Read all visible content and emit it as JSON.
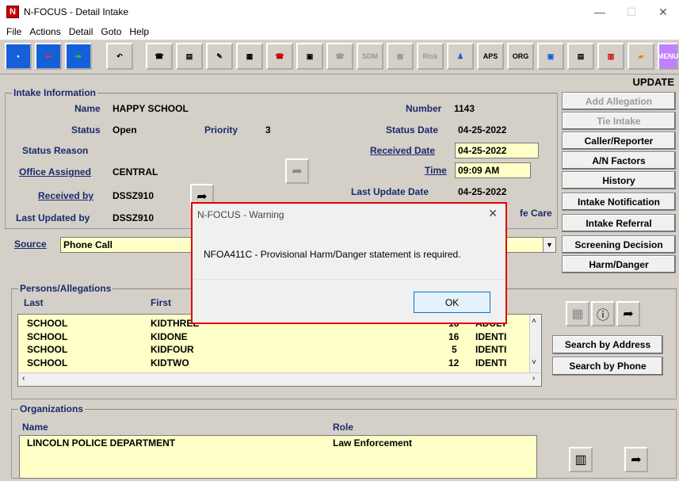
{
  "window": {
    "title": "N-FOCUS - Detail Intake",
    "app_icon_text": "N"
  },
  "menu": [
    "File",
    "Actions",
    "Detail",
    "Goto",
    "Help"
  ],
  "toolbar": {
    "sdm_label": "SDM",
    "risk_label": "Risk",
    "aps_label": "APS",
    "org_label": "ORG",
    "menu_label": "MENU"
  },
  "mode": "UPDATE",
  "intake": {
    "group_label": "Intake Information",
    "name_label": "Name",
    "name_value": "HAPPY SCHOOL",
    "number_label": "Number",
    "number_value": "1143",
    "status_label": "Status",
    "status_value": "Open",
    "priority_label": "Priority",
    "priority_value": "3",
    "status_date_label": "Status Date",
    "status_date_value": "04-25-2022",
    "status_reason_label": "Status Reason",
    "received_date_label": "Received Date",
    "received_date_value": "04-25-2022",
    "office_label": "Office Assigned",
    "office_value": "CENTRAL",
    "time_label": "Time",
    "time_value": "09:09 AM",
    "received_by_label": "Received by",
    "received_by_value": "DSSZ910",
    "last_update_date_label": "Last Update Date",
    "last_update_date_value": "04-25-2022",
    "last_updated_by_label": "Last Updated by",
    "last_updated_by_value": "DSSZ910",
    "partial_label": "fe Care",
    "source_label": "Source",
    "source_value": "Phone Call"
  },
  "right_buttons": [
    {
      "label": "Add Allegation",
      "enabled": false
    },
    {
      "label": "Tie Intake",
      "enabled": false
    },
    {
      "label": "Caller/Reporter",
      "enabled": true
    },
    {
      "label": "A/N Factors",
      "enabled": true
    },
    {
      "label": "History",
      "enabled": true
    },
    {
      "label": "Intake Notification",
      "enabled": true
    },
    {
      "label": "Intake Referral",
      "enabled": true
    },
    {
      "label": "Screening Decision",
      "enabled": true
    },
    {
      "label": "Harm/Danger",
      "enabled": true
    }
  ],
  "persons": {
    "group_label": "Persons/Allegations",
    "col_last": "Last",
    "col_first": "First",
    "rows": [
      {
        "last": "SCHOOL",
        "first": "KIDTHREE",
        "age": "16",
        "role": "ADULT"
      },
      {
        "last": "SCHOOL",
        "first": "KIDONE",
        "age": "16",
        "role": "IDENTI"
      },
      {
        "last": "SCHOOL",
        "first": "KIDFOUR",
        "age": "5",
        "role": "IDENTI"
      },
      {
        "last": "SCHOOL",
        "first": "KIDTWO",
        "age": "12",
        "role": "IDENTI"
      }
    ],
    "search_address": "Search by Address",
    "search_phone": "Search by Phone"
  },
  "organizations": {
    "group_label": "Organizations",
    "col_name": "Name",
    "col_role": "Role",
    "rows": [
      {
        "name": "LINCOLN POLICE DEPARTMENT",
        "role": "Law Enforcement"
      }
    ]
  },
  "dialog": {
    "title": "N-FOCUS - Warning",
    "message": "NFOA411C - Provisional Harm/Danger statement is required.",
    "ok": "OK"
  }
}
